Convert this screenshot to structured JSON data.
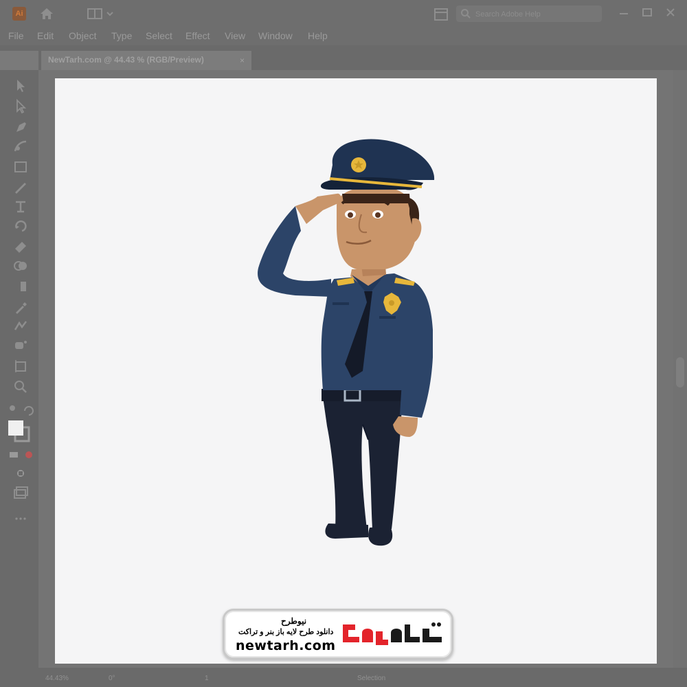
{
  "app": {
    "logo_text": "Ai"
  },
  "search": {
    "placeholder": "Search Adobe Help"
  },
  "menu": [
    "File",
    "Edit",
    "Object",
    "Type",
    "Select",
    "Effect",
    "View",
    "Window",
    "Help"
  ],
  "document": {
    "tab_title": "NewTarh.com @ 44.43 % (RGB/Preview)",
    "close_glyph": "×"
  },
  "status": {
    "zoom": "44.43%",
    "rotation": "0°",
    "artboard": "1",
    "tool": "Selection"
  },
  "watermark": {
    "site": "newtarh.com",
    "brand_fa": "نیوطرح",
    "tagline_fa": "دانلود طرح لایه باز بنر و تراکت",
    "logo_fa": "نیوطرح"
  },
  "tools": [
    "selection-tool",
    "direct-selection-tool",
    "pen-tool",
    "curvature-tool",
    "rectangle-tool",
    "paintbrush-tool",
    "type-tool",
    "rotate-tool",
    "eraser-tool",
    "shape-builder-tool",
    "gradient-tool",
    "eyedropper-tool",
    "blend-tool",
    "symbol-sprayer-tool",
    "artboard-tool",
    "zoom-tool"
  ],
  "colors": {
    "uniform": "#2c4468",
    "pants": "#1b2233",
    "skin": "#c9956a",
    "badge": "#e7b73b",
    "accent_red": "#e3242b"
  }
}
